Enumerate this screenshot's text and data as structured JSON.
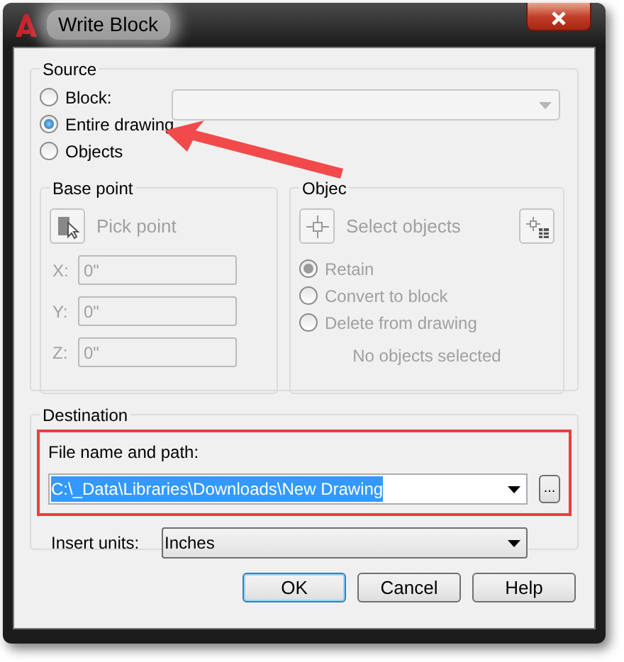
{
  "window": {
    "title": "Write Block"
  },
  "source": {
    "title": "Source",
    "options": [
      {
        "label": "Block:",
        "selected": false
      },
      {
        "label": "Entire drawing",
        "selected": true
      },
      {
        "label": "Objects",
        "selected": false
      }
    ],
    "block_dropdown": {
      "disabled": true
    },
    "base_point": {
      "title": "Base point",
      "disabled": true,
      "pick_button": "Pick point",
      "coords": [
        {
          "label": "X:",
          "value": "0\""
        },
        {
          "label": "Y:",
          "value": "0\""
        },
        {
          "label": "Z:",
          "value": "0\""
        }
      ]
    },
    "objects": {
      "title": "Objec",
      "disabled": true,
      "select_button": "Select objects",
      "options": [
        {
          "label": "Retain",
          "selected": true
        },
        {
          "label": "Convert to block",
          "selected": false
        },
        {
          "label": "Delete from drawing",
          "selected": false
        }
      ],
      "status": "No objects selected"
    }
  },
  "destination": {
    "title": "Destination",
    "file_label": "File name and path:",
    "file_value": "C:\\_Data\\Libraries\\Downloads\\New Drawing",
    "text_selected": true,
    "browse_button": "...",
    "units_label": "Insert units:",
    "units_value": "Inches"
  },
  "buttons": [
    {
      "label": "OK",
      "default": true
    },
    {
      "label": "Cancel",
      "default": false
    },
    {
      "label": "Help",
      "default": false
    }
  ]
}
